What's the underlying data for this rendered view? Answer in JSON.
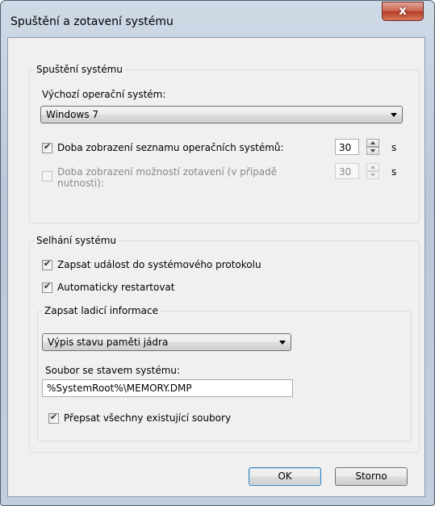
{
  "window": {
    "title": "Spuštění a zotavení systému",
    "close_label": "x"
  },
  "startup": {
    "group_label": "Spuštění systému",
    "default_os_label": "Výchozí operační systém:",
    "default_os_value": "Windows 7",
    "show_os_list_label": "Doba zobrazení seznamu operačních systémů:",
    "show_os_list_checked": true,
    "show_os_list_seconds": "30",
    "show_recovery_label_line1": "Doba zobrazení možností zotavení (v případě",
    "show_recovery_label_line2": "nutnosti):",
    "show_recovery_checked": false,
    "show_recovery_seconds": "30",
    "seconds_unit": "s"
  },
  "failure": {
    "group_label": "Selhání systému",
    "write_event_label": "Zapsat událost do systémového protokolu",
    "write_event_checked": true,
    "auto_restart_label": "Automaticky restartovat",
    "auto_restart_checked": true,
    "debug": {
      "group_label": "Zapsat ladicí informace",
      "dump_type_value": "Výpis stavu paměti jádra",
      "dump_file_label": "Soubor se stavem systému:",
      "dump_file_value": "%SystemRoot%\\MEMORY.DMP",
      "overwrite_label": "Přepsat všechny existující soubory",
      "overwrite_checked": true
    }
  },
  "buttons": {
    "ok": "OK",
    "cancel": "Storno"
  }
}
